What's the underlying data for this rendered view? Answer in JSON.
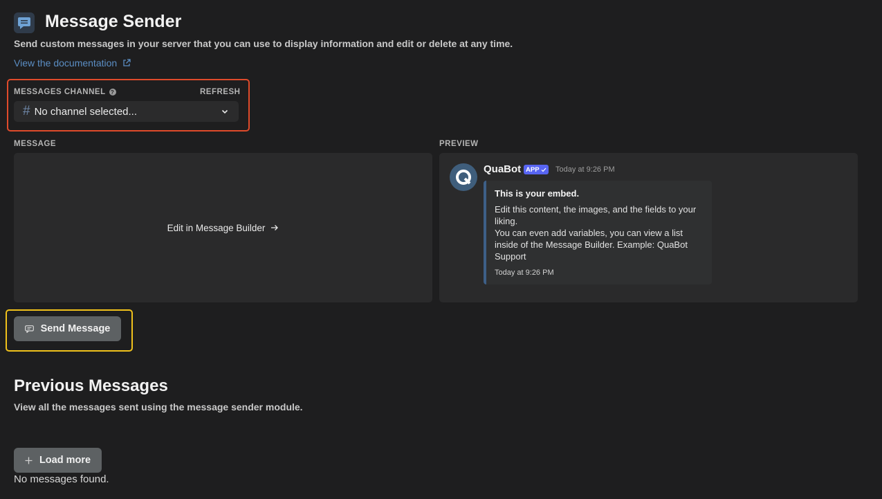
{
  "header": {
    "title": "Message Sender",
    "subtitle": "Send custom messages in your server that you can use to display information and edit or delete at any time.",
    "doc_link": "View the documentation",
    "icon": "message-icon"
  },
  "channel": {
    "label": "MESSAGES CHANNEL",
    "refresh": "REFRESH",
    "hash": "#",
    "value": "No channel selected..."
  },
  "message": {
    "label": "MESSAGE",
    "edit_link": "Edit in Message Builder"
  },
  "preview": {
    "label": "PREVIEW",
    "bot_name": "QuaBot",
    "badge": "APP",
    "time": "Today at 9:26 PM",
    "embed_title": "This is your embed.",
    "embed_desc_1": "Edit this content, the images, and the fields to your liking.",
    "embed_desc_2": "You can even add variables, you can view a list inside of the Message Builder. Example:  QuaBot Support",
    "embed_footer": "Today at 9:26 PM",
    "accent_color": "#3d5f87"
  },
  "actions": {
    "send": "Send Message"
  },
  "previous": {
    "title": "Previous Messages",
    "subtitle": "View all the messages sent using the message sender module.",
    "load_more": "Load more",
    "empty": "No messages found."
  },
  "highlights": {
    "channel_box_color": "#e04b2b",
    "send_box_color": "#f1c21b"
  }
}
